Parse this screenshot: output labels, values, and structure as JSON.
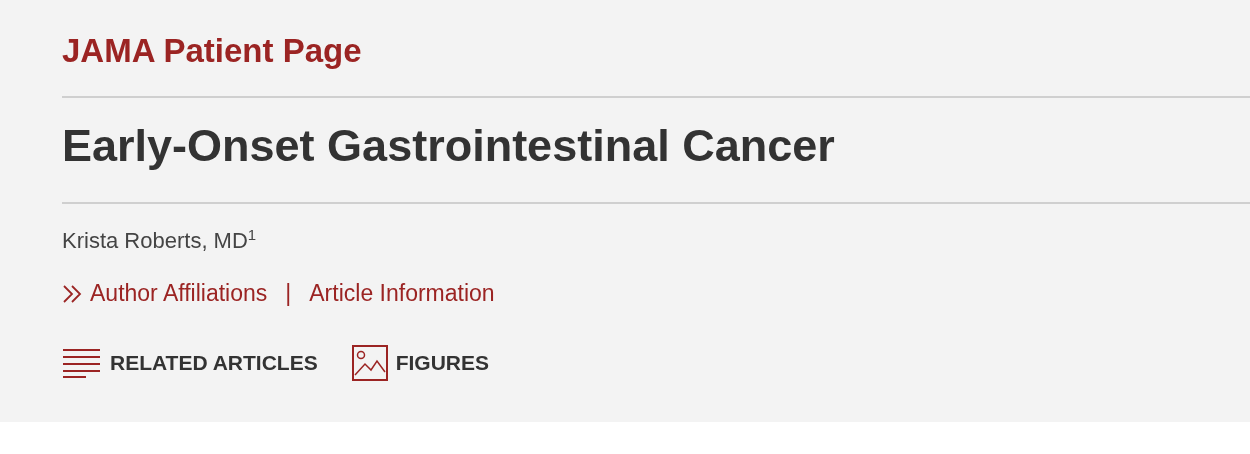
{
  "section": "JAMA Patient Page",
  "title": "Early-Onset Gastrointestinal Cancer",
  "author": "Krista Roberts, MD$^{1}$",
  "links": [
    {
      "label": "Author Affiliations",
      "kind": "expand"
    },
    {
      "label": "|",
      "kind": "separator"
    },
    {
      "label": "Article Information",
      "kind": "link"
    }
  ],
  "tools": [
    {
      "label": "RELATED ARTICLES",
      "kind": "list"
    },
    {
      "label": "FIGURES",
      "kind": "image"
    }
  ]
}
